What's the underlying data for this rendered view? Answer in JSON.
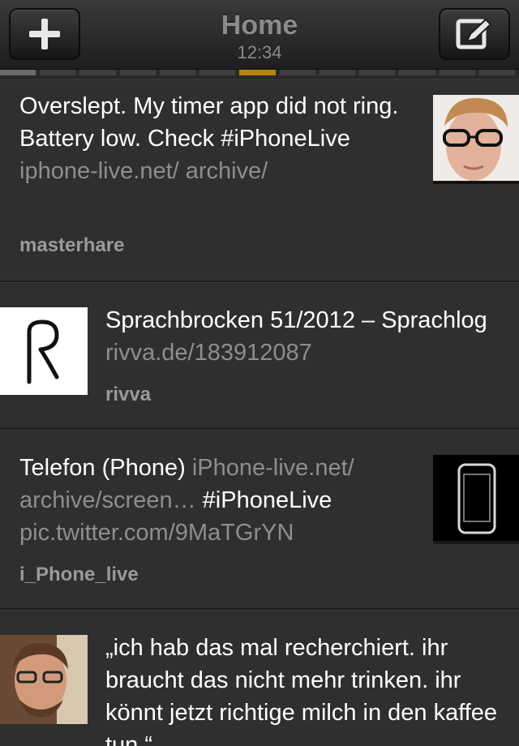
{
  "navbar": {
    "title": "Home",
    "time": "12:34",
    "add_icon": "plus-icon",
    "compose_icon": "compose-icon"
  },
  "colors": {
    "background": "#2f2f2f",
    "text": "#ffffff",
    "link": "#8e8e8e",
    "username": "#9a9a9a",
    "pager_active": "#b8860b"
  },
  "tweets": [
    {
      "text": "Overslept. My timer app did not ring. Battery low. Check #iPhoneLive ",
      "link": "iphone-live.net/ archive/",
      "username": "masterhare"
    },
    {
      "text": "Sprachbrocken 51/2012 – Sprachlog ",
      "link": "rivva.de/183912087",
      "username": "rivva"
    },
    {
      "text": "Telefon (Phone) ",
      "link": "iPhone-live.net/ archive/screen…",
      "text2": " #iPhoneLive",
      "link2": "pic.twitter.com/9MaTGrYN",
      "username": "i_Phone_live"
    },
    {
      "text": "„ich hab das mal recherchiert. ihr braucht das nicht mehr trinken. ihr könnt jetzt richtige milch in den kaffee tun.“"
    }
  ]
}
